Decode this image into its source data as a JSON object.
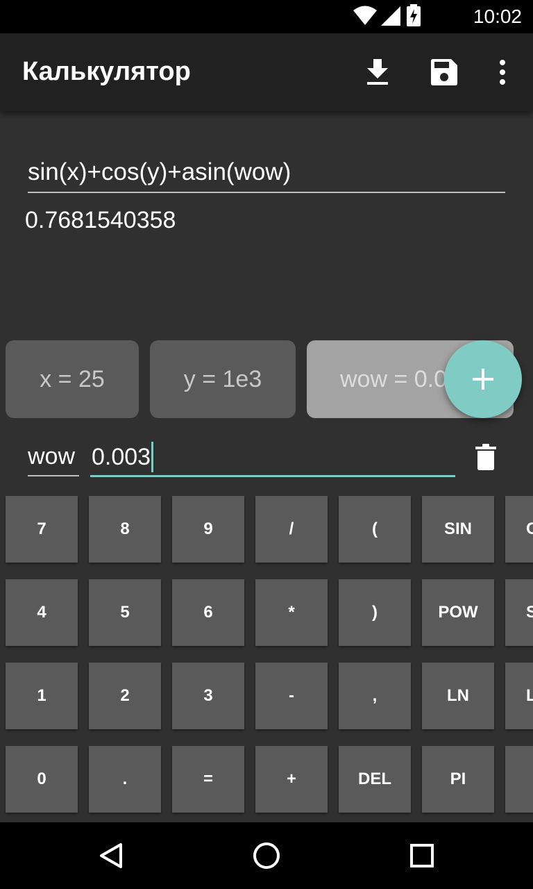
{
  "status_bar": {
    "time": "10:02"
  },
  "app_bar": {
    "title": "Калькулятор"
  },
  "expression": {
    "value": "sin(x)+cos(y)+asin(wow)"
  },
  "result": {
    "value": "0.7681540358"
  },
  "variables": [
    {
      "label": "x = 25"
    },
    {
      "label": "y = 1e3"
    },
    {
      "label": "wow = 0.0"
    }
  ],
  "editor": {
    "name": "wow",
    "value": "0.003"
  },
  "keypad": {
    "rows": [
      [
        "7",
        "8",
        "9",
        "/",
        "(",
        "SIN",
        "C"
      ],
      [
        "4",
        "5",
        "6",
        "*",
        ")",
        "POW",
        "SC"
      ],
      [
        "1",
        "2",
        "3",
        "-",
        ",",
        "LN",
        "L"
      ],
      [
        "0",
        ".",
        "=",
        "+",
        "DEL",
        "PI",
        ""
      ]
    ]
  },
  "colors": {
    "accent": "#80cbc4",
    "app_bar": "#212121",
    "background": "#303030",
    "key": "#5a5a5a"
  },
  "icons": [
    "download-icon",
    "save-icon",
    "more-vert-icon",
    "plus-icon",
    "trash-icon",
    "back-icon",
    "home-icon",
    "recents-icon",
    "wifi-icon",
    "signal-icon",
    "battery-charging-icon"
  ]
}
